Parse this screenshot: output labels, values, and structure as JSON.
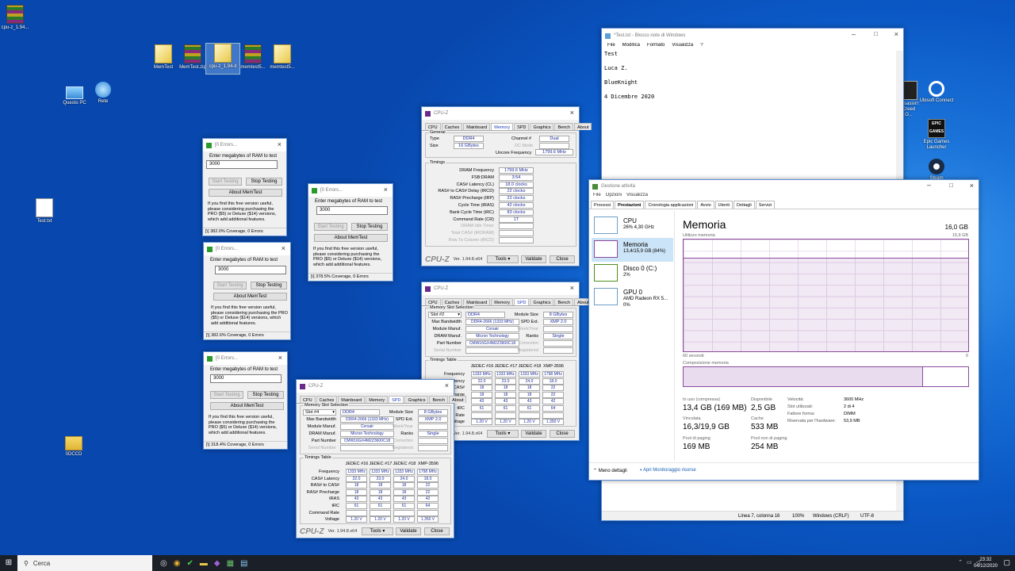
{
  "desktop": {
    "icons": [
      {
        "label": "cpu-z_1.94...",
        "kind": "rar"
      },
      {
        "label": "MemTest",
        "kind": "file"
      },
      {
        "label": "MemTest.zip",
        "kind": "rar"
      },
      {
        "label": "cpu-z_1.94-it",
        "kind": "file"
      },
      {
        "label": "memtest5...",
        "kind": "rar"
      },
      {
        "label": "memtest5...",
        "kind": "file"
      },
      {
        "label": "Questo PC",
        "kind": "pc"
      },
      {
        "label": "Rete",
        "kind": "net"
      },
      {
        "label": "Test.txt",
        "kind": "doc"
      },
      {
        "label": "0DCCD",
        "kind": "folder"
      },
      {
        "label": "Assassin's Creed O...",
        "kind": "app"
      },
      {
        "label": "Ubisoft Connect",
        "kind": "app"
      },
      {
        "label": "Epic Games Launcher",
        "kind": "app"
      },
      {
        "label": "Steam",
        "kind": "app"
      }
    ]
  },
  "memtest": [
    {
      "title": "[0 Errors...",
      "prompt": "Enter megabytes of RAM to test",
      "value": "3000",
      "start": "Start Testing",
      "stop": "Stop Testing",
      "about": "About MemTest",
      "desc": "If you find this free version useful, please considering purchasing the PRO ($5) or Deluxe ($14) versions, which add additional features.",
      "status": "382.0% Coverage, 0 Errors"
    },
    {
      "title": "[0 Errors...",
      "prompt": "Enter megabytes of RAM to test",
      "value": "3000",
      "start": "Start Testing",
      "stop": "Stop Testing",
      "about": "About MemTest",
      "desc": "If you find this free version useful, please considering purchasing the PRO ($5) or Deluxe ($14) versions, which add additional features.",
      "status": "382.6% Coverage, 0 Errors"
    },
    {
      "title": "[0 Errors...",
      "prompt": "Enter megabytes of RAM to test",
      "value": "3000",
      "start": "Start Testing",
      "stop": "Stop Testing",
      "about": "About MemTest",
      "desc": "If you find this free version useful, please considering purchasing the PRO ($5) or Deluxe ($14) versions, which add additional features.",
      "status": "318.4% Coverage, 0 Errors"
    },
    {
      "title": "[0 Errors...",
      "prompt": "Enter megabytes of RAM to test",
      "value": "3000",
      "start": "Start Testing",
      "stop": "Stop Testing",
      "about": "About MemTest",
      "desc": "If you find this free version useful, please considering purchasing the PRO ($5) or Deluxe ($14) versions, which add additional features.",
      "status": "378.5% Coverage, 0 Errors"
    }
  ],
  "cpuz_tabs": [
    "CPU",
    "Caches",
    "Mainboard",
    "Memory",
    "SPD",
    "Graphics",
    "Bench",
    "About"
  ],
  "cpuz_mem": {
    "title": "CPU-Z",
    "general": "General",
    "type_l": "Type",
    "type": "DDR4",
    "size_l": "Size",
    "size": "16 GBytes",
    "channel_l": "Channel #",
    "channel": "Dual",
    "dc_l": "DC Mode",
    "uncore_l": "Uncore Frequency",
    "uncore": "1799.6 MHz",
    "timings": "Timings",
    "rows": [
      [
        "DRAM Frequency",
        "1799.6 MHz"
      ],
      [
        "FSB:DRAM",
        "3:54"
      ],
      [
        "CAS# Latency (CL)",
        "18.0 clocks"
      ],
      [
        "RAS# to CAS# Delay (tRCD)",
        "22 clocks"
      ],
      [
        "RAS# Precharge (tRP)",
        "22 clocks"
      ],
      [
        "Cycle Time (tRAS)",
        "42 clocks"
      ],
      [
        "Bank Cycle Time (tRC)",
        "83 clocks"
      ],
      [
        "Command Rate (CR)",
        "1T"
      ],
      [
        "DRAM Idle Timer",
        ""
      ],
      [
        "Total CAS# (tRDRAM)",
        ""
      ],
      [
        "Row To Column (tRCD)",
        ""
      ]
    ],
    "logo": "CPU-Z",
    "version": "Ver. 1.94.8.x64",
    "tools": "Tools",
    "validate": "Validate",
    "close": "Close"
  },
  "cpuz_spd": [
    {
      "title": "CPU-Z",
      "sel_group": "Memory Slot Selection",
      "slot": "Slot #2",
      "type": "DDR4",
      "module_size_l": "Module Size",
      "module_size": "8 GBytes",
      "bw_l": "Max Bandwidth",
      "bw": "DDR4-2666 (1333 MHz)",
      "spd_ext_l": "SPD Ext.",
      "spd_ext": "XMP 2.0",
      "mm_l": "Module Manuf.",
      "mm": "Corsair",
      "week_l": "Week/Year",
      "dram_l": "DRAM Manuf.",
      "dram": "Micron Technology",
      "ranks_l": "Ranks",
      "ranks": "Single",
      "pn_l": "Part Number",
      "pn": "CMW16GX4M2Z3600C18",
      "corr_l": "Correction",
      "sn_l": "Serial Number",
      "reg_l": "Registered",
      "tt": "Timings Table",
      "cols": [
        "JEDEC #16",
        "JEDEC #17",
        "JEDEC #18",
        "XMP-3596"
      ],
      "trows": [
        [
          "Frequency",
          "1333 MHz",
          "1333 MHz",
          "1333 MHz",
          "1798 MHz"
        ],
        [
          "CAS# Latency",
          "22.0",
          "23.0",
          "24.0",
          "18.0"
        ],
        [
          "RAS# to CAS#",
          "18",
          "18",
          "18",
          "22"
        ],
        [
          "RAS# Precharge",
          "18",
          "18",
          "18",
          "22"
        ],
        [
          "tRAS",
          "43",
          "43",
          "43",
          "42"
        ],
        [
          "tRC",
          "61",
          "61",
          "61",
          "64"
        ],
        [
          "Command Rate",
          "",
          "",
          "",
          ""
        ],
        [
          "Voltage",
          "1.20 V",
          "1.20 V",
          "1.20 V",
          "1.350 V"
        ]
      ],
      "version": "Ver. 1.94.8.x64",
      "tools": "Tools",
      "validate": "Validate",
      "close": "Close"
    },
    {
      "title": "CPU-Z",
      "sel_group": "Memory Slot Selection",
      "slot": "Slot #4",
      "type": "DDR4",
      "module_size_l": "Module Size",
      "module_size": "8 GBytes",
      "bw_l": "Max Bandwidth",
      "bw": "DDR4-2666 (1333 MHz)",
      "spd_ext_l": "SPD Ext.",
      "spd_ext": "XMP 2.0",
      "mm_l": "Module Manuf.",
      "mm": "Corsair",
      "week_l": "Week/Year",
      "dram_l": "DRAM Manuf.",
      "dram": "Micron Technology",
      "ranks_l": "Ranks",
      "ranks": "Single",
      "pn_l": "Part Number",
      "pn": "CMW16GX4M2Z3600C18",
      "corr_l": "Correction",
      "sn_l": "Serial Number",
      "reg_l": "Registered",
      "tt": "Timings Table",
      "cols": [
        "JEDEC #16",
        "JEDEC #17",
        "JEDEC #18",
        "XMP-3596"
      ],
      "trows": [
        [
          "Frequency",
          "1333 MHz",
          "1333 MHz",
          "1333 MHz",
          "1798 MHz"
        ],
        [
          "CAS# Latency",
          "22.0",
          "23.0",
          "24.0",
          "18.0"
        ],
        [
          "RAS# to CAS#",
          "18",
          "18",
          "18",
          "22"
        ],
        [
          "RAS# Precharge",
          "18",
          "18",
          "18",
          "22"
        ],
        [
          "tRAS",
          "43",
          "43",
          "43",
          "42"
        ],
        [
          "tRC",
          "61",
          "61",
          "61",
          "64"
        ],
        [
          "Command Rate",
          "",
          "",
          "",
          ""
        ],
        [
          "Voltage",
          "1.20 V",
          "1.20 V",
          "1.20 V",
          "1.350 V"
        ]
      ],
      "version": "Ver. 1.94.8.x64",
      "tools": "Tools",
      "validate": "Validate",
      "close": "Close"
    }
  ],
  "notepad": {
    "title": "*Test.txt - Blocco note di Windows",
    "menu": [
      "File",
      "Modifica",
      "Formato",
      "Visualizza",
      "?"
    ],
    "lines": [
      "Test",
      "Luca Z.",
      "BlueKnight",
      "4 Dicembre 2020"
    ],
    "status": [
      "Linea 7, colonna 16",
      "100%",
      "Windows (CRLF)",
      "UTF-8"
    ]
  },
  "taskmgr": {
    "title": "Gestione attività",
    "menu": [
      "File",
      "Opzioni",
      "Visualizza"
    ],
    "tabs": [
      "Processi",
      "Prestazioni",
      "Cronologia applicazioni",
      "Avvio",
      "Utenti",
      "Dettagli",
      "Servizi"
    ],
    "side": [
      {
        "name": "CPU",
        "sub": "26% 4,30 GHz",
        "sub2": ""
      },
      {
        "name": "Memoria",
        "sub": "13,4/15,9 GB (84%)",
        "sub2": ""
      },
      {
        "name": "Disco 0 (C:)",
        "sub": "2%",
        "sub2": ""
      },
      {
        "name": "GPU 0",
        "sub": "AMD Radeon RX 5...",
        "sub2": "0%"
      }
    ],
    "heading": "Memoria",
    "total": "16,0 GB",
    "usage_l": "Utilizzo memoria",
    "usage_max": "15,9 GB",
    "t60": "60 secondi",
    "t0": "0",
    "comp_l": "Composizione memoria",
    "usage_fraction": 0.84,
    "stats": [
      [
        "In uso (compressa)",
        "13,4 GB (169 MB)"
      ],
      [
        "Disponibile",
        "2,5 GB"
      ],
      [
        "Vincolata",
        "16,3/19,9 GB"
      ],
      [
        "Cache",
        "533 MB"
      ],
      [
        "Pool di paging",
        "169 MB"
      ],
      [
        "Pool non di paging",
        "254 MB"
      ]
    ],
    "right": [
      [
        "Velocità:",
        "3600 MHz"
      ],
      [
        "Slot utilizzati:",
        "2 di 4"
      ],
      [
        "Fattore forma:",
        "DIMM"
      ],
      [
        "Riservata per l'hardware:",
        "53,9 MB"
      ]
    ],
    "less": "Meno dettagli",
    "monitor": "Apri Monitoraggio risorse"
  },
  "taskbar": {
    "search": "Cerca",
    "time": "23:32",
    "date": "04/12/2020"
  }
}
